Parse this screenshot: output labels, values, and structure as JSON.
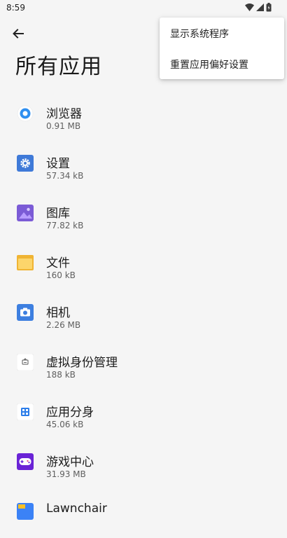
{
  "status_bar": {
    "time": "8:59"
  },
  "header": {
    "title": "所有应用"
  },
  "menu": {
    "items": [
      "显示系统程序",
      "重置应用偏好设置"
    ]
  },
  "apps": [
    {
      "name": "浏览器",
      "size": "0.91 MB",
      "icon": "browser-icon",
      "color": "#2f8ff0"
    },
    {
      "name": "设置",
      "size": "57.34 kB",
      "icon": "settings-gear-icon",
      "color": "#3f7ad8"
    },
    {
      "name": "图库",
      "size": "77.82 kB",
      "icon": "gallery-icon",
      "color": "#7b5bd6"
    },
    {
      "name": "文件",
      "size": "160 kB",
      "icon": "folder-icon",
      "color": "#f0b433"
    },
    {
      "name": "相机",
      "size": "2.26 MB",
      "icon": "camera-icon",
      "color": "#3d7fe0"
    },
    {
      "name": "虚拟身份管理",
      "size": "188 kB",
      "icon": "identity-icon",
      "color": "#ffffff"
    },
    {
      "name": "应用分身",
      "size": "45.06 kB",
      "icon": "app-clone-icon",
      "color": "#2b7de9"
    },
    {
      "name": "游戏中心",
      "size": "31.93 MB",
      "icon": "gamepad-icon",
      "color": "#6a23d6"
    },
    {
      "name": "Lawnchair",
      "size": "",
      "icon": "lawnchair-icon",
      "color": "#3b82f6"
    }
  ]
}
